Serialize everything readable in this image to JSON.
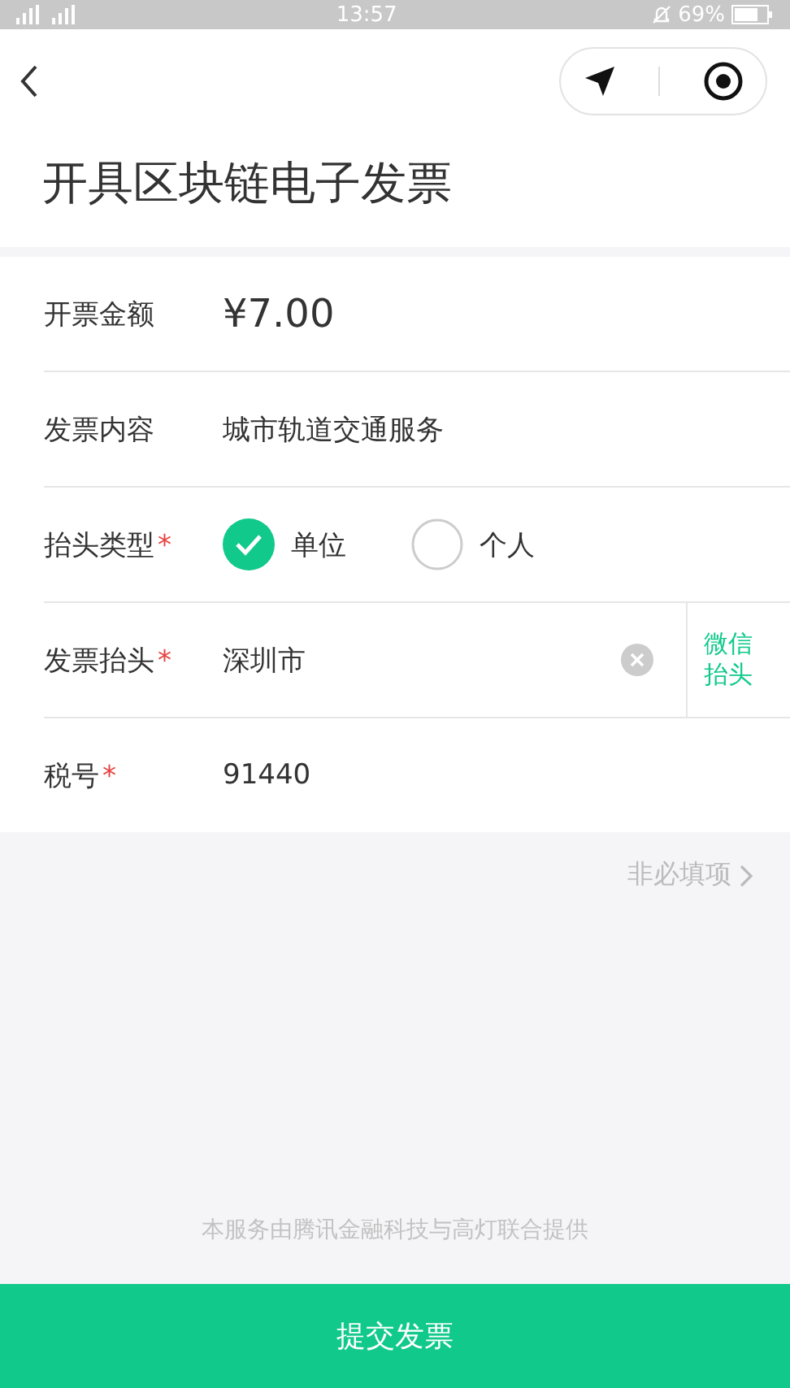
{
  "status_bar": {
    "time": "13:57",
    "battery": "69%"
  },
  "title": "开具区块链电子发票",
  "fields": [
    {
      "kind": "amount",
      "label": "开票金额",
      "value": "¥7.00"
    },
    {
      "kind": "text",
      "label": "发票内容",
      "value": "城市轨道交通服务"
    },
    {
      "kind": "radio",
      "label": "抬头类型",
      "asterisk": "*",
      "options": [
        {
          "label": "单位",
          "selected": true
        },
        {
          "label": "个人",
          "selected": false
        }
      ]
    },
    {
      "kind": "input",
      "label": "发票抬头",
      "asterisk": "*",
      "value": "深圳市",
      "clearable": true,
      "side_button": "微信抬头"
    },
    {
      "kind": "input",
      "label": "税号",
      "asterisk": "*",
      "value": "91440"
    }
  ],
  "optional_link": "非必填项",
  "footer": "本服务由腾讯金融科技与高灯联合提供",
  "submit": "提交发票"
}
